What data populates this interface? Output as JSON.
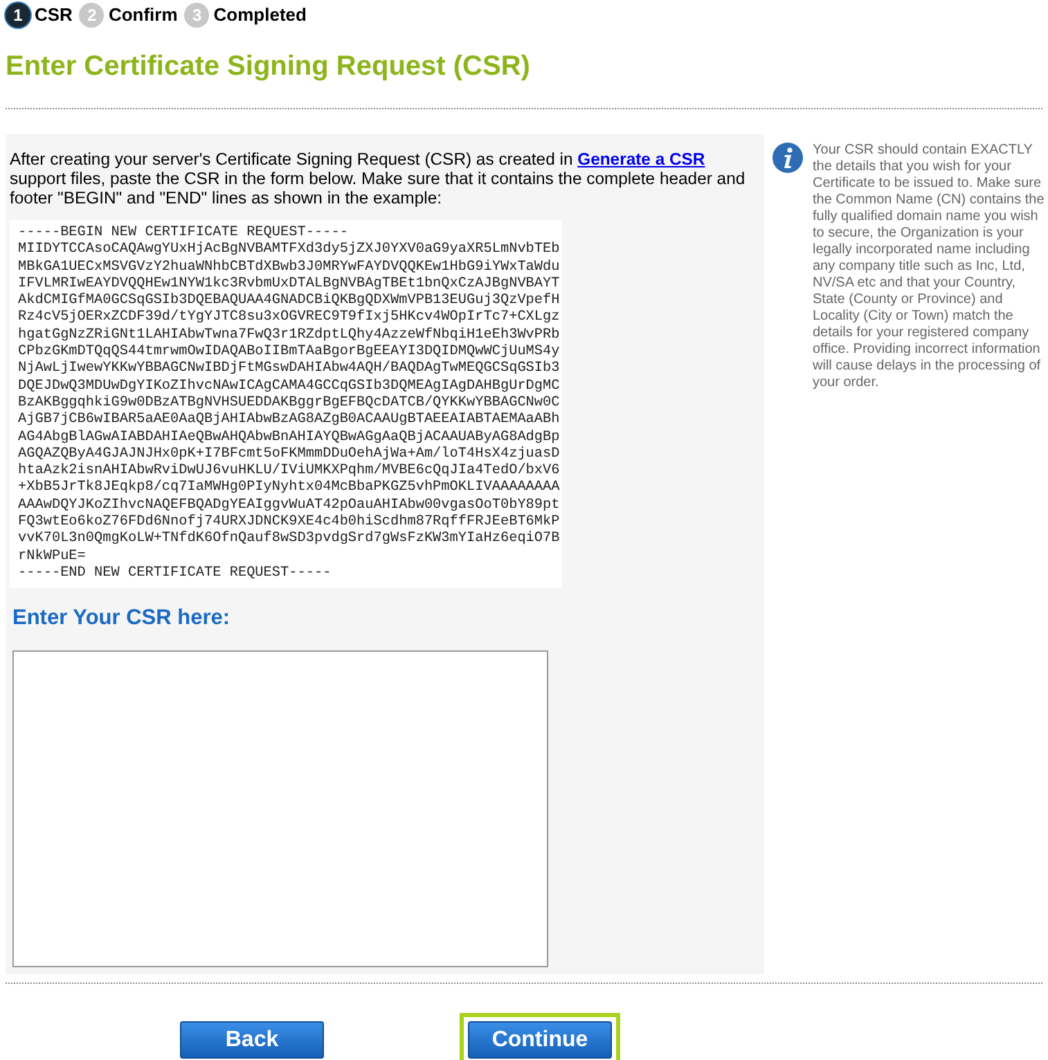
{
  "steps": [
    {
      "number": "1",
      "label": "CSR",
      "selected": true
    },
    {
      "number": "2",
      "label": "Confirm",
      "selected": false
    },
    {
      "number": "3",
      "label": "Completed",
      "selected": false
    }
  ],
  "title": "Enter Certificate Signing Request (CSR)",
  "intro": {
    "before": "After creating your server's Certificate Signing Request (CSR) as created in ",
    "link": "Generate a CSR",
    "after": " support files, paste the CSR in the form below. Make sure that it contains the complete header and footer \"BEGIN\" and \"END\" lines as shown in the example:"
  },
  "example_csr": [
    "-----BEGIN NEW CERTIFICATE REQUEST-----",
    "MIIDYTCCAsoCAQAwgYUxHjAcBgNVBAMTFXd3dy5jZXJ0YXV0aG9yaXR5LmNvbTEb",
    "MBkGA1UECxMSVGVzY2huaWNhbCBTdXBwb3J0MRYwFAYDVQQKEw1HbG9iYWxTaWdu",
    "IFVLMRIwEAYDVQQHEw1NYW1kc3RvbmUxDTALBgNVBAgTBEt1bnQxCzAJBgNVBAYT",
    "AkdCMIGfMA0GCSqGSIb3DQEBAQUAA4GNADCBiQKBgQDXWmVPB13EUGuj3QzVpefH",
    "Rz4cV5jOERxZCDF39d/tYgYJTC8su3xOGVREC9T9fIxj5HKcv4WOpIrTc7+CXLgz",
    "hgatGgNzZRiGNt1LAHIAbwTwna7FwQ3r1RZdptLQhy4AzzeWfNbqiH1eEh3WvPRb",
    "CPbzGKmDTQqQS44tmrwmOwIDAQABoIIBmTAaBgorBgEEAYI3DQIDMQwWCjUuMS4y",
    "NjAwLjIwewYKKwYBBAGCNwIBDjFtMGswDAHIAbw4AQH/BAQDAgTwMEQGCSqGSIb3",
    "DQEJDwQ3MDUwDgYIKoZIhvcNAwICAgCAMA4GCCqGSIb3DQMEAgIAgDAHBgUrDgMC",
    "BzAKBggqhkiG9w0DBzATBgNVHSUEDDAKBggrBgEFBQcDATCB/QYKKwYBBAGCNw0C",
    "AjGB7jCB6wIBAR5aAE0AaQBjAHIAbwBzAG8AZgB0ACAAUgBTAEEAIABTAEMAaABh",
    "AG4AbgBlAGwAIABDAHIAeQBwAHQAbwBnAHIAYQBwAGgAaQBjACAAUAByAG8AdgBp",
    "AGQAZQByA4GJAJNJHx0pK+I7BFcmt5oFKMmmDDuOehAjWa+Am/loT4HsX4zjuasD",
    "htaAzk2isnAHIAbwRviDwUJ6vuHKLU/IViUMKXPqhm/MVBE6cQqJIa4TedO/bxV6",
    "+XbB5JrTk8JEqkp8/cq7IaMWHg0PIyNyhtx04McBbaPKGZ5vhPmOKLIVAAAAAAAA",
    "AAAwDQYJKoZIhvcNAQEFBQADgYEAIggvWuAT42pOauAHIAbw00vgasOoT0bY89pt",
    "FQ3wtEo6koZ76FDd6Nnofj74URXJDNCK9XE4c4b0hiScdhm87RqffFRJEeBT6MkP",
    "vvK70L3n0QmgKoLW+TNfdK6OfnQauf8wSD3pvdgSrd7gWsFzKW3mYIaHz6eqiO7B",
    "rNkWPuE=",
    "-----END NEW CERTIFICATE REQUEST-----"
  ],
  "csr_field": {
    "label": "Enter Your CSR here:"
  },
  "info": "Your CSR should contain EXACTLY the details that you wish for your Certificate to be issued to. Make sure the Common Name (CN) contains the fully qualified domain name you wish to secure, the Organization is your legally incorporated name including any company title such as Inc, Ltd, NV/SA etc and that your Country, State (County or Province) and Locality (City or Town) match the details for your registered company office. Providing incorrect information will cause delays in the processing of your order.",
  "buttons": [
    {
      "label": "Back",
      "highlighted": false
    },
    {
      "label": "Continue",
      "highlighted": true
    }
  ]
}
